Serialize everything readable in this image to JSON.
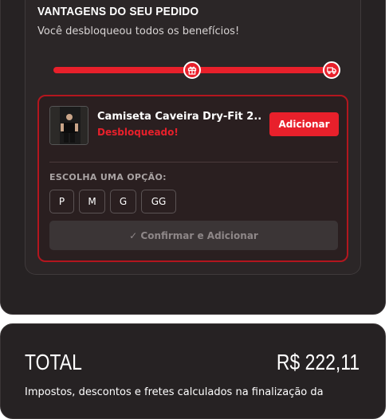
{
  "benefits": {
    "title": "VANTAGENS DO SEU PEDIDO",
    "subtitle": "Você desbloqueou todos os benefícios!",
    "progress_fraction": 1.0,
    "accent_color": "#e8202b",
    "milestones": [
      {
        "icon": "gift-icon"
      },
      {
        "icon": "truck-icon"
      }
    ]
  },
  "offer": {
    "product_name": "Camiseta Caveira Dry-Fit 2....",
    "status": "Desbloqueado!",
    "add_label": "Adicionar",
    "option_label": "ESCOLHA UMA OPÇÃO:",
    "sizes": [
      "P",
      "M",
      "G",
      "GG"
    ],
    "confirm_label": "✓ Confirmar e Adicionar"
  },
  "summary": {
    "total_label": "TOTAL",
    "total_value": "R$ 222,11",
    "note": "Impostos, descontos e fretes calculados na finalização da"
  }
}
